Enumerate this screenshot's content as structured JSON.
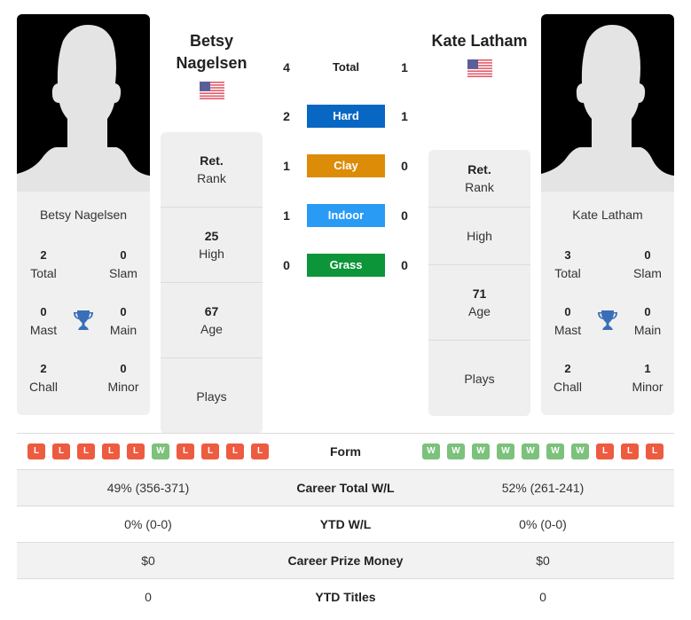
{
  "players": [
    {
      "name": "Betsy Nagelsen",
      "name_line1": "Betsy",
      "name_line2": "Nagelsen",
      "country_flag": "us-flag-icon",
      "titles": {
        "total": {
          "value": "2",
          "label": "Total"
        },
        "slam": {
          "value": "0",
          "label": "Slam"
        },
        "mast": {
          "value": "0",
          "label": "Mast"
        },
        "main": {
          "value": "0",
          "label": "Main"
        },
        "chall": {
          "value": "2",
          "label": "Chall"
        },
        "minor": {
          "value": "0",
          "label": "Minor"
        }
      },
      "stats": {
        "rank": {
          "value": "Ret.",
          "label": "Rank"
        },
        "high": {
          "value": "25",
          "label": "High"
        },
        "age": {
          "value": "67",
          "label": "Age"
        },
        "plays": {
          "value": "",
          "label": "Plays"
        }
      },
      "form": [
        "L",
        "L",
        "L",
        "L",
        "L",
        "W",
        "L",
        "L",
        "L",
        "L"
      ]
    },
    {
      "name": "Kate Latham",
      "country_flag": "us-flag-icon",
      "titles": {
        "total": {
          "value": "3",
          "label": "Total"
        },
        "slam": {
          "value": "0",
          "label": "Slam"
        },
        "mast": {
          "value": "0",
          "label": "Mast"
        },
        "main": {
          "value": "0",
          "label": "Main"
        },
        "chall": {
          "value": "2",
          "label": "Chall"
        },
        "minor": {
          "value": "1",
          "label": "Minor"
        }
      },
      "stats": {
        "rank": {
          "value": "Ret.",
          "label": "Rank"
        },
        "high": {
          "value": "",
          "label": "High"
        },
        "age": {
          "value": "71",
          "label": "Age"
        },
        "plays": {
          "value": "",
          "label": "Plays"
        }
      },
      "form": [
        "W",
        "W",
        "W",
        "W",
        "W",
        "W",
        "W",
        "L",
        "L",
        "L"
      ]
    }
  ],
  "h2h": {
    "total": {
      "label": "Total",
      "left": "4",
      "right": "1"
    },
    "surfaces": [
      {
        "label": "Hard",
        "left": "2",
        "right": "1",
        "color": "#0867c2"
      },
      {
        "label": "Clay",
        "left": "1",
        "right": "0",
        "color": "#dd8c08"
      },
      {
        "label": "Indoor",
        "left": "1",
        "right": "0",
        "color": "#2a9bf5"
      },
      {
        "label": "Grass",
        "left": "0",
        "right": "0",
        "color": "#0d9539"
      }
    ]
  },
  "comparison": {
    "form_label": "Form",
    "rows": [
      {
        "label": "Career Total W/L",
        "left": "49% (356-371)",
        "right": "52% (261-241)"
      },
      {
        "label": "YTD W/L",
        "left": "0% (0-0)",
        "right": "0% (0-0)"
      },
      {
        "label": "Career Prize Money",
        "left": "$0",
        "right": "$0"
      },
      {
        "label": "YTD Titles",
        "left": "0",
        "right": "0"
      }
    ]
  },
  "colors": {
    "loss": "#ed5b40",
    "win": "#7cc17c",
    "trophy": "#3a6fb7"
  }
}
